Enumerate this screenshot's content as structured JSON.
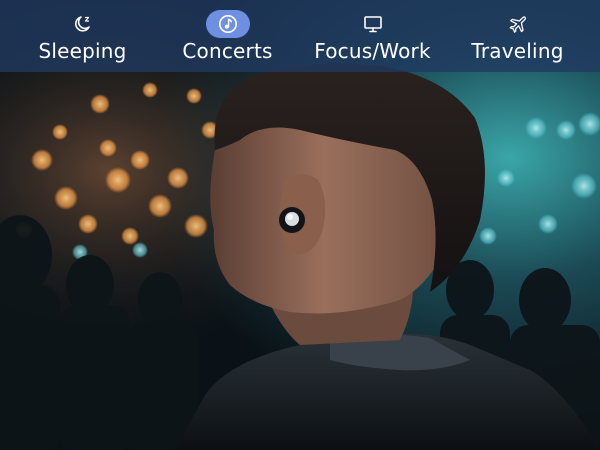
{
  "tabs": [
    {
      "label": "Sleeping",
      "icon": "moon-sleep-icon",
      "active": false
    },
    {
      "label": "Concerts",
      "icon": "music-note-icon",
      "active": true
    },
    {
      "label": "Focus/Work",
      "icon": "monitor-icon",
      "active": false
    },
    {
      "label": "Traveling",
      "icon": "airplane-icon",
      "active": false
    }
  ],
  "colors": {
    "tabbar_bg": "#213a60",
    "active_pill": "#6f8fe0",
    "text": "#ffffff"
  },
  "hero_image": "man-with-earbud-at-concert-photo"
}
